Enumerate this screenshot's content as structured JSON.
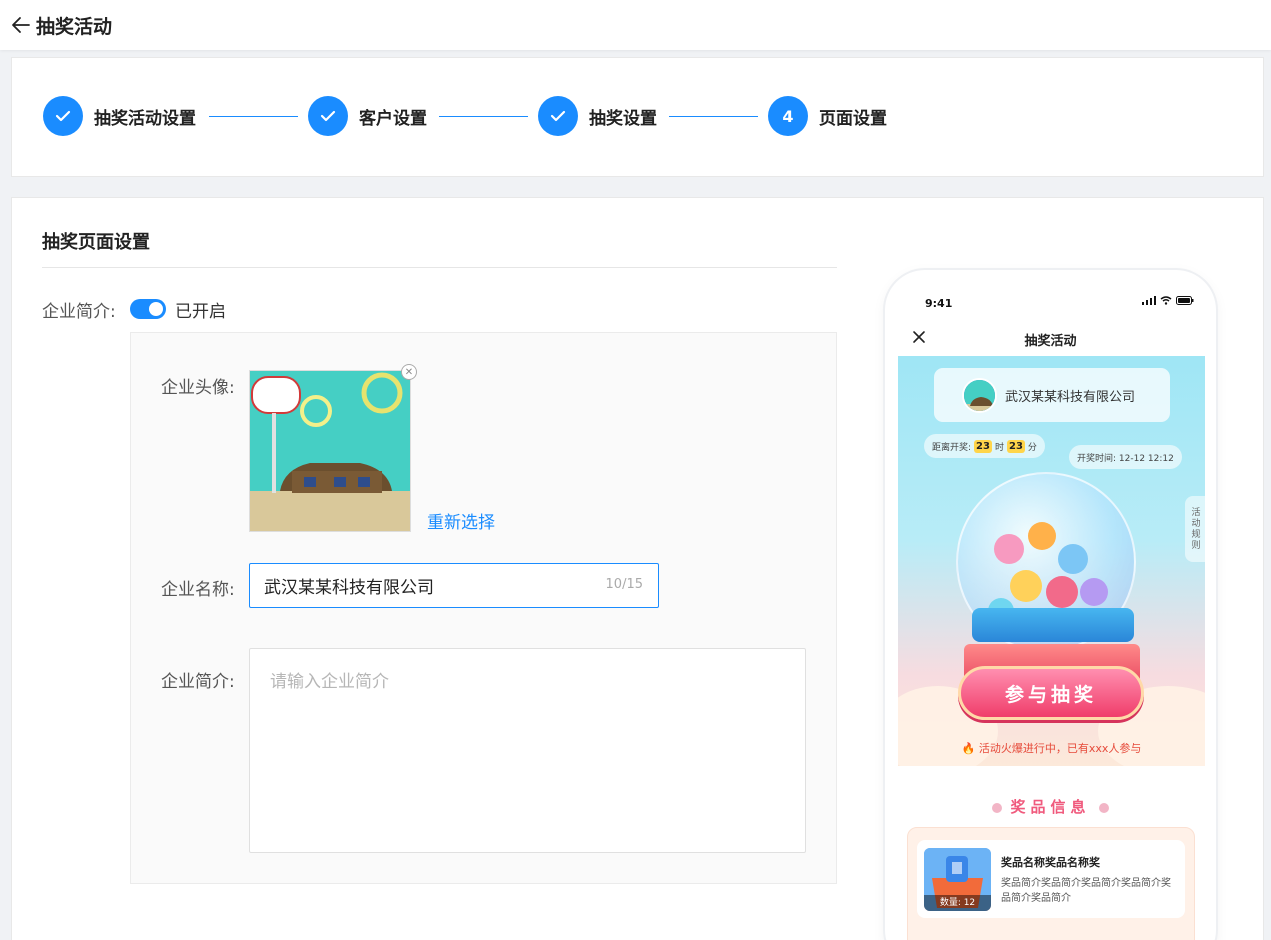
{
  "header": {
    "title": "抽奖活动"
  },
  "steps": [
    {
      "label": "抽奖活动设置",
      "state": "done"
    },
    {
      "label": "客户设置",
      "state": "done"
    },
    {
      "label": "抽奖设置",
      "state": "done"
    },
    {
      "label": "页面设置",
      "state": "active",
      "number": "4"
    }
  ],
  "section": {
    "title": "抽奖页面设置"
  },
  "company_intro_toggle": {
    "label": "企业简介:",
    "status": "已开启",
    "on": true
  },
  "form": {
    "avatar_label": "企业头像:",
    "reselect": "重新选择",
    "name_label": "企业名称:",
    "name_value": "武汉某某科技有限公司",
    "name_count": "10/15",
    "intro_label": "企业简介:",
    "intro_placeholder": "请输入企业简介"
  },
  "phone": {
    "time": "9:41",
    "title": "抽奖活动",
    "company_name": "武汉某某科技有限公司",
    "countdown_prefix": "距离开奖:",
    "countdown_hours": "23",
    "countdown_hours_unit": "时",
    "countdown_minutes": "23",
    "countdown_minutes_unit": "分",
    "draw_time": "开奖时间: 12-12 12:12",
    "rules": "活动规则",
    "join_button": "参与抽奖",
    "hot_text": "🔥 活动火爆进行中，已有xxx人参与",
    "prize_section_title": "奖品信息",
    "prize": {
      "name": "奖品名称奖品名称奖",
      "desc": "奖品简介奖品简介奖品简介奖品简介奖品简介奖品简介",
      "qty": "数量: 12"
    }
  },
  "colors": {
    "primary": "#1a8cff",
    "accent_pink": "#f05a7d"
  }
}
